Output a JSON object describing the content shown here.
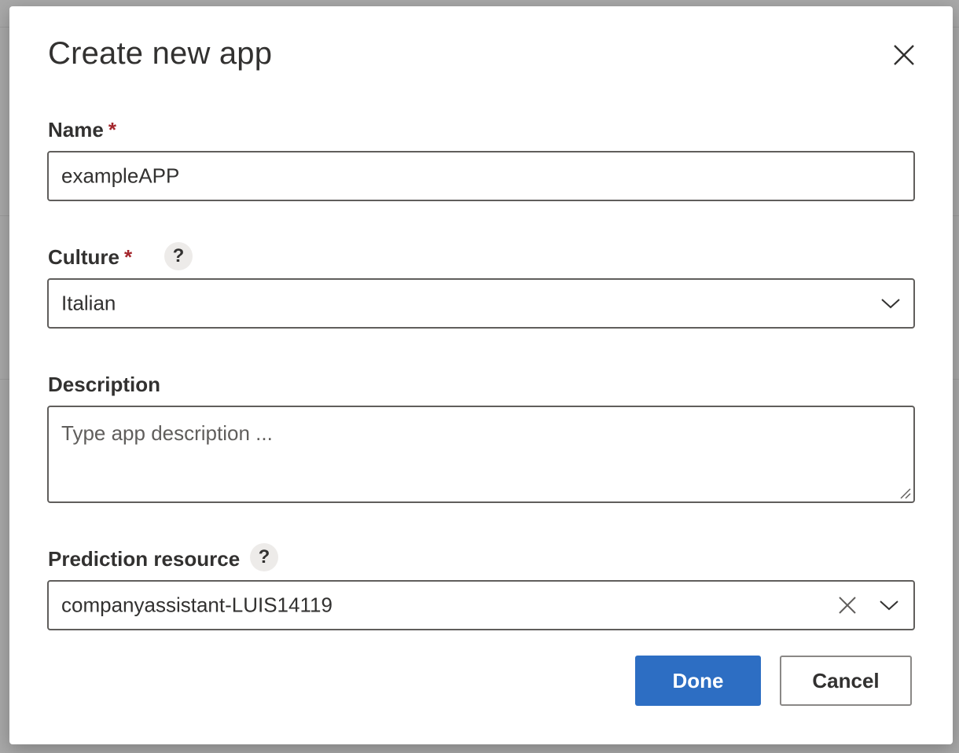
{
  "dialog": {
    "title": "Create new app",
    "close_icon": "close-icon"
  },
  "fields": {
    "name": {
      "label": "Name",
      "required_marker": "*",
      "value": "exampleAPP"
    },
    "culture": {
      "label": "Culture",
      "required_marker": "*",
      "help": "?",
      "selected": "Italian",
      "icon": "chevron-down-icon"
    },
    "description": {
      "label": "Description",
      "placeholder": "Type app description ..."
    },
    "prediction_resource": {
      "label": "Prediction resource",
      "help": "?",
      "selected": "companyassistant-LUIS14119",
      "clear_icon": "clear-icon",
      "icon": "chevron-down-icon"
    }
  },
  "actions": {
    "done_label": "Done",
    "cancel_label": "Cancel"
  },
  "colors": {
    "primary": "#2d6ec3",
    "required": "#a4262c",
    "overlay": "#a9a9a9"
  }
}
